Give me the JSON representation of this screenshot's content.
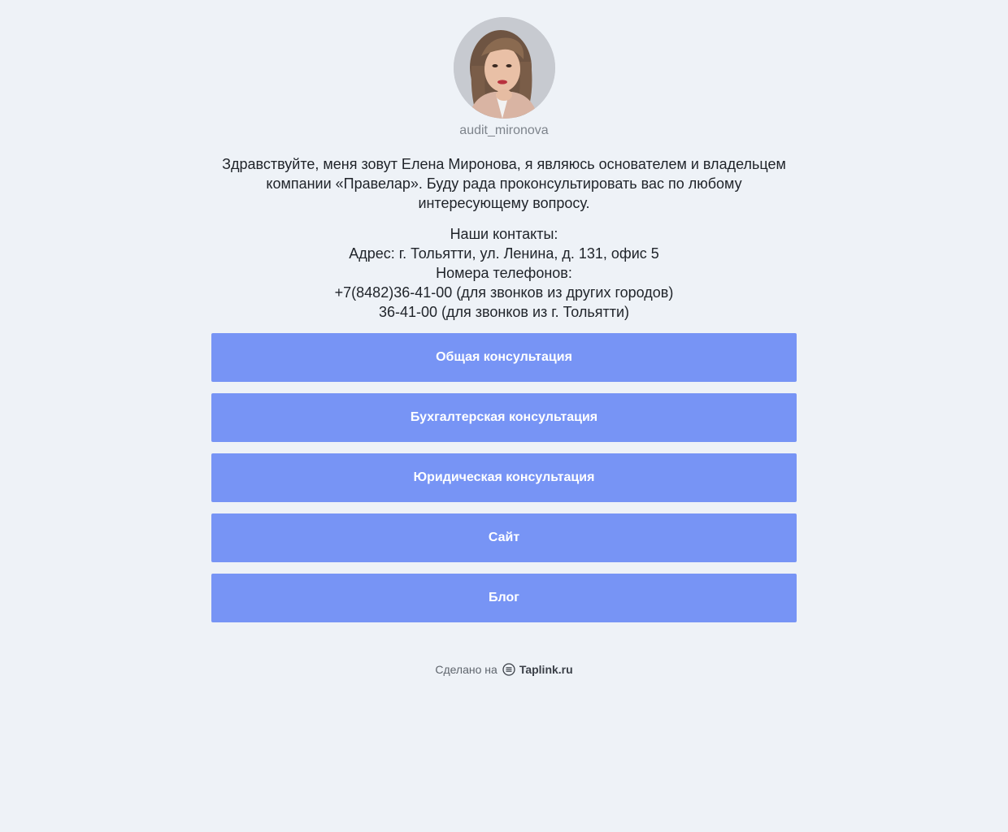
{
  "profile": {
    "username": "audit_mironova",
    "bio": "Здравствуйте, меня зовут Елена Миронова, я являюсь основателем и владельцем компании «Правелар». Буду рада проконсультировать вас по любому интересующему вопросу."
  },
  "contacts": {
    "heading": "Наши контакты:",
    "address": "Адрес: г. Тольятти, ул. Ленина, д. 131, офис 5",
    "phones_label": "Номера телефонов:",
    "phone_other_cities": "+7(8482)36-41-00 (для звонков из других городов)",
    "phone_local": "36-41-00 (для звонков из г. Тольятти)"
  },
  "buttons": [
    {
      "label": "Общая консультация"
    },
    {
      "label": "Бухгалтерская консультация"
    },
    {
      "label": "Юридическая консультация"
    },
    {
      "label": "Сайт"
    },
    {
      "label": "Блог"
    }
  ],
  "footer": {
    "made_on": "Сделано на",
    "brand": "Taplink.ru",
    "icon": "taplink-logo-icon"
  },
  "colors": {
    "background": "#eef2f7",
    "button": "#7794f5",
    "button_text": "#ffffff"
  }
}
